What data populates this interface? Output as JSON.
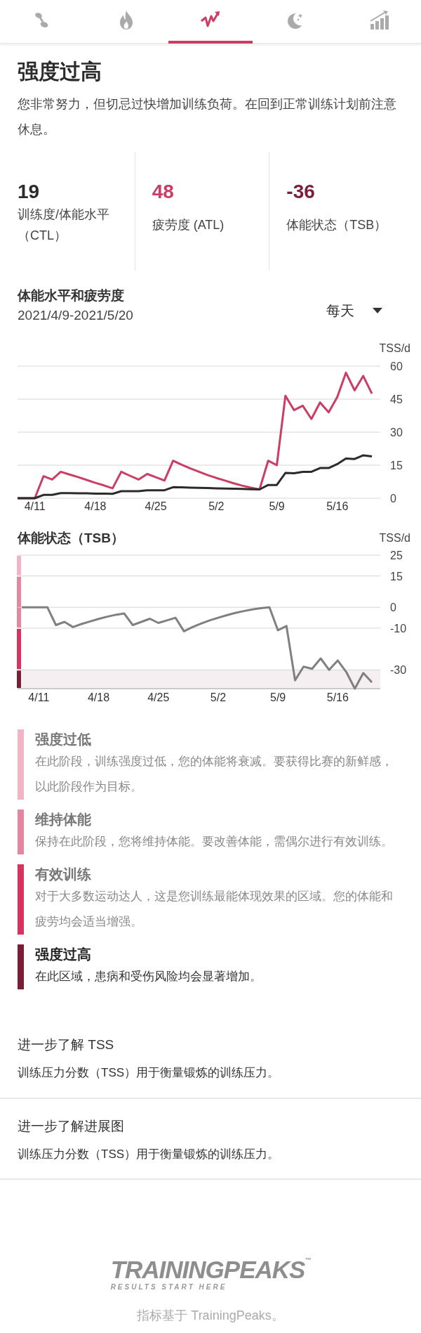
{
  "tabs": [
    {
      "kind": "footprints",
      "selected": false
    },
    {
      "kind": "flame",
      "selected": false
    },
    {
      "kind": "pulse",
      "selected": true
    },
    {
      "kind": "moon",
      "selected": false
    },
    {
      "kind": "bars",
      "selected": false
    }
  ],
  "status": {
    "title": "强度过高",
    "description": "您非常努力，但切忌过快增加训练负荷。在回到正常训练计划前注意休息。"
  },
  "metrics": [
    {
      "value": "19",
      "label": "训练度/体能水平（CTL）",
      "color": "#2b2b2b"
    },
    {
      "value": "48",
      "label": "疲劳度 (ATL)",
      "color": "#cc3d64"
    },
    {
      "value": "-36",
      "label": "体能状态（TSB）",
      "color": "#7b1f38"
    }
  ],
  "fitness_chart": {
    "title": "体能水平和疲劳度",
    "date_range": "2021/4/9-2021/5/20",
    "period": "每天",
    "chart_data": {
      "type": "line",
      "ylabel": "TSS/d",
      "grid": true,
      "ylim": [
        0,
        60
      ],
      "yticks": [
        0,
        15,
        30,
        45,
        60
      ],
      "categories": [
        null,
        null,
        "4/11",
        null,
        null,
        null,
        null,
        null,
        null,
        "4/18",
        null,
        null,
        null,
        null,
        null,
        null,
        "4/25",
        null,
        null,
        null,
        null,
        null,
        null,
        "5/2",
        null,
        null,
        null,
        null,
        null,
        null,
        "5/9",
        null,
        null,
        null,
        null,
        null,
        null,
        "5/16",
        null,
        null,
        null,
        null
      ],
      "series": [
        {
          "color": "#cc3d64",
          "values": [
            0,
            0,
            0,
            10,
            8.5,
            12,
            10.8,
            9.6,
            8.3,
            7,
            5.8,
            4.5,
            12,
            10.2,
            8.5,
            11,
            9.5,
            8,
            17,
            15.2,
            13.5,
            12,
            10.5,
            9.2,
            8,
            6.8,
            5.7,
            4.8,
            4,
            17,
            15,
            46.5,
            40,
            42,
            36,
            43.5,
            39,
            46,
            57,
            49,
            55.5,
            47.5
          ]
        },
        {
          "color": "#2b2b2b",
          "values": [
            0,
            0,
            0,
            1.5,
            1.5,
            2.3,
            2.3,
            2.2,
            2.2,
            2.1,
            2.1,
            2,
            3.2,
            3.2,
            3.2,
            3.6,
            3.6,
            3.6,
            5,
            4.9,
            4.8,
            4.7,
            4.6,
            4.5,
            4.4,
            4.3,
            4.2,
            4.1,
            4,
            6,
            6,
            11.5,
            11.3,
            12,
            12,
            13.7,
            13.7,
            15.5,
            18,
            17.8,
            19.5,
            19
          ]
        }
      ]
    }
  },
  "form_chart": {
    "title": "体能状态（TSB）",
    "chart_data": {
      "type": "line",
      "ylabel": "TSS/d",
      "ylim": [
        -39,
        25
      ],
      "yticks": [
        -30,
        -10,
        0,
        15,
        25
      ],
      "categories": [
        null,
        null,
        "4/11",
        null,
        null,
        null,
        null,
        null,
        null,
        "4/18",
        null,
        null,
        null,
        null,
        null,
        null,
        "4/25",
        null,
        null,
        null,
        null,
        null,
        null,
        "5/2",
        null,
        null,
        null,
        null,
        null,
        null,
        "5/9",
        null,
        null,
        null,
        null,
        null,
        null,
        "5/16",
        null,
        null,
        null,
        null
      ],
      "series": [
        {
          "color": "#808080",
          "values": [
            0,
            0,
            0,
            0,
            -8.5,
            -7,
            -9.5,
            -8,
            -6.8,
            -5.6,
            -4.5,
            -3.6,
            -3,
            -8.5,
            -7,
            -5.5,
            -7.5,
            -6.3,
            -5,
            -11.5,
            -9.5,
            -7.8,
            -6.3,
            -5,
            -3.8,
            -2.7,
            -1.8,
            -1,
            -0.4,
            0,
            -11,
            -9,
            -35,
            -28.5,
            -29.5,
            -24.5,
            -30,
            -25.5,
            -31,
            -39,
            -31.5,
            -36
          ]
        }
      ],
      "grid": true
    }
  },
  "zones": [
    {
      "title": "强度过低",
      "description": "在此阶段，训练强度过低，您的体能将衰减。要获得比赛的新鲜感，以此阶段作为目标。",
      "color": "#f2b3c4",
      "selected": false
    },
    {
      "title": "维持体能",
      "description": "保持在此阶段，您将维持体能。要改善体能，需偶尔进行有效训练。",
      "color": "#e2879f",
      "selected": false
    },
    {
      "title": "有效训练",
      "description": "对于大多数运动达人，这是您训练最能体现效果的区域。您的体能和疲劳均会适当增强。",
      "color": "#d6335e",
      "selected": false
    },
    {
      "title": "强度过高",
      "description": "在此区域，患病和受伤风险均会显著增加。",
      "color": "#7c1d36",
      "selected": true
    }
  ],
  "links": [
    {
      "title": "进一步了解 TSS",
      "description": "训练压力分数（TSS）用于衡量锻炼的训练压力。"
    },
    {
      "title": "进一步了解进展图",
      "description": "训练压力分数（TSS）用于衡量锻炼的训练压力。"
    }
  ],
  "footer": {
    "logo": "TRAININGPEAKS",
    "trademark": "™",
    "tagline": "RESULTS START HERE",
    "note": "指标基于 TrainingPeaks。"
  }
}
